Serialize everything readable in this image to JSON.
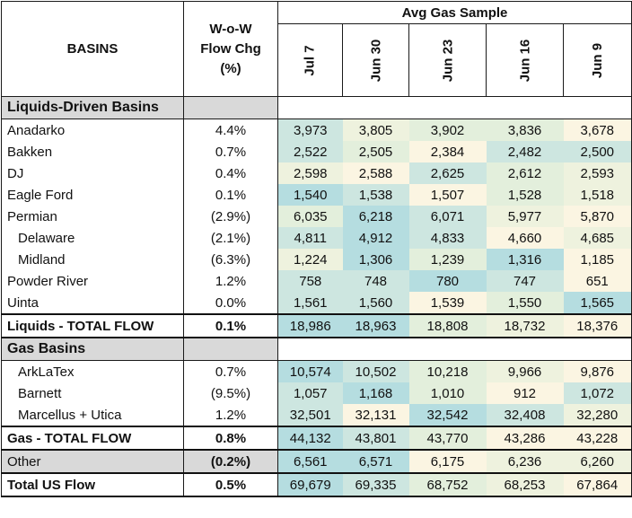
{
  "header": {
    "basins": "BASINS",
    "wow_line1": "W-o-W",
    "wow_line2": "Flow Chg",
    "wow_line3": "(%)",
    "sample_title": "Avg Gas Sample",
    "dates": [
      "Jul 7",
      "Jun 30",
      "Jun 23",
      "Jun 16",
      "Jun 9"
    ]
  },
  "sections": {
    "liquids": "Liquids-Driven Basins",
    "gas": "Gas Basins"
  },
  "liquids_rows": [
    {
      "name": "Anadarko",
      "chg": "4.4%",
      "values": [
        "3,973",
        "3,805",
        "3,902",
        "3,836",
        "3,678"
      ]
    },
    {
      "name": "Bakken",
      "chg": "0.7%",
      "values": [
        "2,522",
        "2,505",
        "2,384",
        "2,482",
        "2,500"
      ]
    },
    {
      "name": "DJ",
      "chg": "0.4%",
      "values": [
        "2,598",
        "2,588",
        "2,625",
        "2,612",
        "2,593"
      ]
    },
    {
      "name": "Eagle Ford",
      "chg": "0.1%",
      "values": [
        "1,540",
        "1,538",
        "1,507",
        "1,528",
        "1,518"
      ]
    },
    {
      "name": "Permian",
      "chg": "(2.9%)",
      "values": [
        "6,035",
        "6,218",
        "6,071",
        "5,977",
        "5,870"
      ]
    },
    {
      "name": "Delaware",
      "chg": "(2.1%)",
      "values": [
        "4,811",
        "4,912",
        "4,833",
        "4,660",
        "4,685"
      ]
    },
    {
      "name": "Midland",
      "chg": "(6.3%)",
      "values": [
        "1,224",
        "1,306",
        "1,239",
        "1,316",
        "1,185"
      ]
    },
    {
      "name": "Powder River",
      "chg": "1.2%",
      "values": [
        "758",
        "748",
        "780",
        "747",
        "651"
      ]
    },
    {
      "name": "Uinta",
      "chg": "0.0%",
      "values": [
        "1,561",
        "1,560",
        "1,539",
        "1,550",
        "1,565"
      ]
    }
  ],
  "liquids_total": {
    "name": "Liquids - TOTAL FLOW",
    "chg": "0.1%",
    "values": [
      "18,986",
      "18,963",
      "18,808",
      "18,732",
      "18,376"
    ]
  },
  "gas_rows": [
    {
      "name": "ArkLaTex",
      "chg": "0.7%",
      "values": [
        "10,574",
        "10,502",
        "10,218",
        "9,966",
        "9,876"
      ]
    },
    {
      "name": "Barnett",
      "chg": "(9.5%)",
      "values": [
        "1,057",
        "1,168",
        "1,010",
        "912",
        "1,072"
      ]
    },
    {
      "name": "Marcellus + Utica",
      "chg": "1.2%",
      "values": [
        "32,501",
        "32,131",
        "32,542",
        "32,408",
        "32,280"
      ]
    }
  ],
  "gas_total": {
    "name": "Gas - TOTAL FLOW",
    "chg": "0.8%",
    "values": [
      "44,132",
      "43,801",
      "43,770",
      "43,286",
      "43,228"
    ]
  },
  "other": {
    "name": "Other",
    "chg": "(0.2%)",
    "values": [
      "6,561",
      "6,571",
      "6,175",
      "6,236",
      "6,260"
    ]
  },
  "total_us": {
    "name": "Total US Flow",
    "chg": "0.5%",
    "values": [
      "69,679",
      "69,335",
      "68,752",
      "68,253",
      "67,864"
    ]
  }
}
